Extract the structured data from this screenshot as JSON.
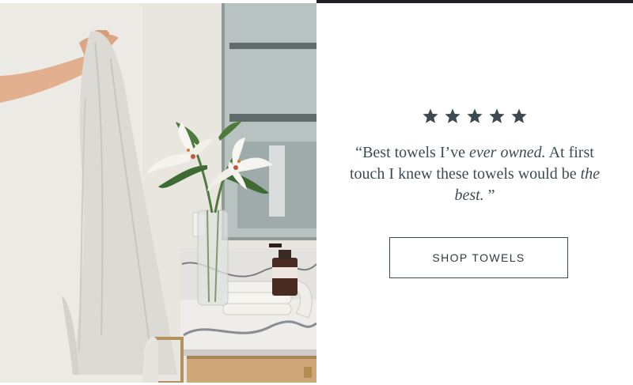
{
  "review": {
    "rating": 5,
    "star_color": "#3c4a52",
    "star_icon": "star-icon",
    "quote": {
      "open_mark": "“",
      "part1": "Best towels I’ve ",
      "emph1": "ever owned.",
      "part2": "  At first touch I knew these towels would be ",
      "emph2": "the best.",
      "close_mark": " ”"
    }
  },
  "cta": {
    "label": "SHOP TOWELS"
  },
  "colors": {
    "text": "#3d4b53",
    "border": "#3e4a52"
  }
}
